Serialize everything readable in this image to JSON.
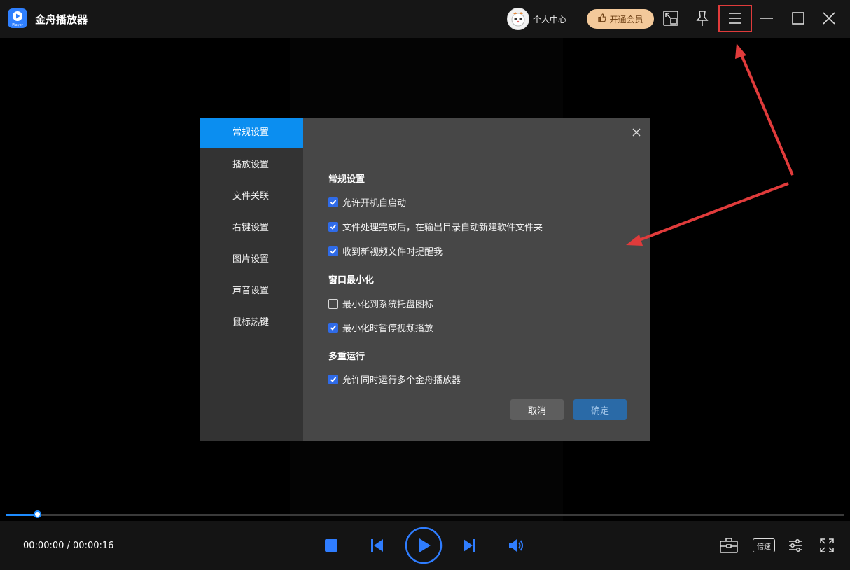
{
  "app": {
    "title": "金舟播放器",
    "logo_sub": "Player"
  },
  "titlebar": {
    "user_center": "个人中心",
    "vip_button": "开通会员",
    "icons": [
      "mini-mode-icon",
      "pin-icon",
      "menu-icon",
      "minimize-icon",
      "maximize-icon",
      "close-icon"
    ]
  },
  "dialog": {
    "nav": [
      {
        "label": "常规设置",
        "active": true
      },
      {
        "label": "播放设置",
        "active": false
      },
      {
        "label": "文件关联",
        "active": false
      },
      {
        "label": "右键设置",
        "active": false
      },
      {
        "label": "图片设置",
        "active": false
      },
      {
        "label": "声音设置",
        "active": false
      },
      {
        "label": "鼠标热键",
        "active": false
      }
    ],
    "sections": [
      {
        "title": "常规设置",
        "options": [
          {
            "label": "允许开机自启动",
            "checked": true
          },
          {
            "label": "文件处理完成后，在输出目录自动新建软件文件夹",
            "checked": true
          },
          {
            "label": "收到新视频文件时提醒我",
            "checked": true
          }
        ]
      },
      {
        "title": "窗口最小化",
        "options": [
          {
            "label": "最小化到系统托盘图标",
            "checked": false
          },
          {
            "label": "最小化时暂停视频播放",
            "checked": true
          }
        ]
      },
      {
        "title": "多重运行",
        "options": [
          {
            "label": "允许同时运行多个金舟播放器",
            "checked": true
          }
        ]
      }
    ],
    "cancel_label": "取消",
    "ok_label": "确定"
  },
  "player": {
    "time_display": "00:00:00 / 00:00:16",
    "progress_fraction": 0.038,
    "speed_label": "倍速"
  },
  "colors": {
    "accent": "#0b8ef0",
    "checkbox": "#2f6be8",
    "annotation": "#e03b3b"
  }
}
